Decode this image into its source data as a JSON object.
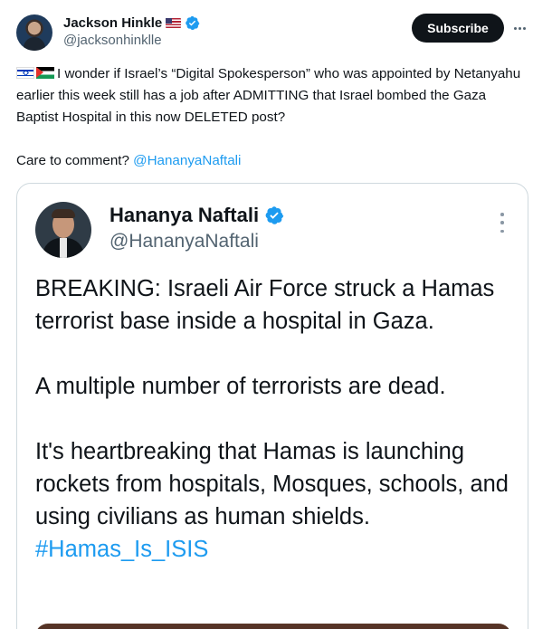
{
  "author": {
    "name": "Jackson Hinkle",
    "handle": "@jacksonhinklle",
    "flag_icon": "us-flag-icon"
  },
  "actions": {
    "subscribe_label": "Subscribe",
    "more_icon": "ellipsis-horizontal-icon"
  },
  "tweet": {
    "line1": "I wonder if Israel’s “Digital Spokesperson” who was appointed by Netanyahu earlier this week still has a job after ADMITTING that Israel bombed the Gaza Baptist Hospital in this now DELETED post?",
    "line2_prefix": "Care to comment? ",
    "mention": "@HananyaNaftali",
    "flag_icons": [
      "israel-flag-icon",
      "palestine-flag-icon"
    ]
  },
  "quoted": {
    "name": "Hananya Naftali",
    "handle": "@HananyaNaftali",
    "p1": "BREAKING: Israeli Air Force struck a Hamas terrorist base inside a hospital in Gaza.",
    "p2": "A multiple number of terrorists are dead.",
    "p3": "It's heartbreaking that Hamas is launching rockets from hospitals, Mosques, schools, and using civilians as human shields.",
    "hashtag": "#Hamas_Is_ISIS"
  },
  "colors": {
    "accent": "#1d9bf0",
    "text": "#0f1419",
    "muted": "#536471",
    "border": "#cfd9de"
  }
}
